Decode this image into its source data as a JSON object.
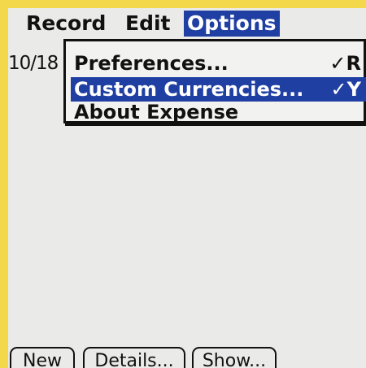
{
  "menubar": {
    "items": [
      {
        "label": "Record"
      },
      {
        "label": "Edit"
      },
      {
        "label": "Options"
      }
    ]
  },
  "list": {
    "first_date": "10/18"
  },
  "dropdown": {
    "items": [
      {
        "label": "Preferences...",
        "shortcut": "✓R"
      },
      {
        "label": "Custom Currencies...",
        "shortcut": "✓Y"
      },
      {
        "label": "About Expense",
        "shortcut": ""
      }
    ]
  },
  "buttons": {
    "new_label": "New",
    "details_label": "Details...",
    "show_label": "Show..."
  },
  "colors": {
    "highlight": "#1f3fa3",
    "background": "#eaeae9",
    "frame": "#f2d84a"
  }
}
